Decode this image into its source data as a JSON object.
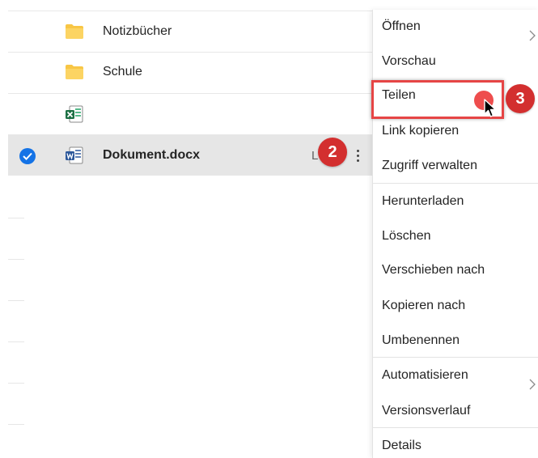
{
  "files": [
    {
      "name": "Notizbücher",
      "type": "folder",
      "selected": false
    },
    {
      "name": "Schule",
      "type": "folder",
      "selected": false
    },
    {
      "name": "",
      "type": "excel",
      "selected": false
    },
    {
      "name": "Dokument.docx",
      "type": "word",
      "selected": true,
      "truncated_column": "L"
    }
  ],
  "steps": {
    "step2": "2",
    "step3": "3"
  },
  "menu": {
    "items": [
      {
        "label": "Öffnen",
        "has_submenu": true
      },
      {
        "label": "Vorschau"
      },
      {
        "label": "Teilen",
        "highlighted": true
      },
      {
        "label": "Link kopieren"
      },
      {
        "label": "Zugriff verwalten"
      },
      {
        "label": "Herunterladen"
      },
      {
        "label": "Löschen"
      },
      {
        "label": "Verschieben nach"
      },
      {
        "label": "Kopieren nach"
      },
      {
        "label": "Umbenennen"
      },
      {
        "label": "Automatisieren",
        "has_submenu": true
      },
      {
        "label": "Versionsverlauf"
      },
      {
        "label": "Details"
      }
    ]
  },
  "colors": {
    "accent_blue": "#1473e6",
    "badge_red": "#d32f2f",
    "highlight_red": "#e64545",
    "folder_yellow": "#f8c645",
    "excel_green": "#1d7044",
    "word_blue": "#2b579a"
  }
}
